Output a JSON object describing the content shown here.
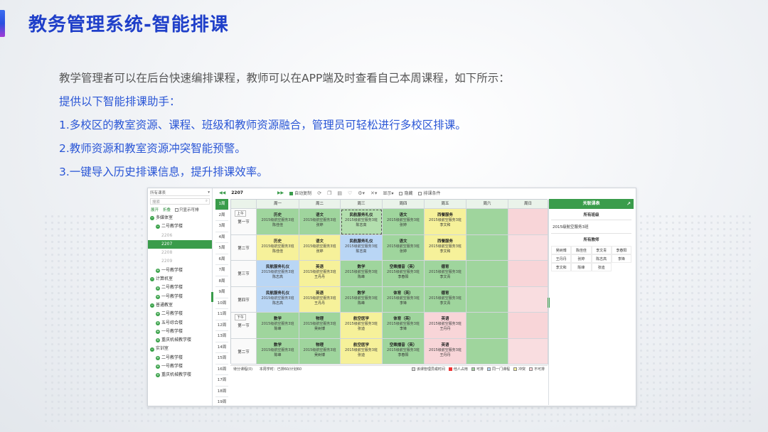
{
  "slide": {
    "title": "教务管理系统-智能排课",
    "intro": [
      "教学管理者可以在后台快速编排课程，教师可以在APP端及时查看自己本周课程，如下所示：",
      "提供以下智能排课助手：",
      "1.多校区的教室资源、课程、班级和教师资源融合，管理员可轻松进行多校区排课。",
      "2.教师资源和教室资源冲突智能预警。",
      "3.一键导入历史排课信息，提升排课效率。"
    ]
  },
  "app": {
    "tree": {
      "select_label": "所有课表",
      "search_placeholder": "搜索",
      "expand": "展开",
      "collapse": "折叠",
      "only_show": "只显示可排",
      "items": [
        {
          "label": "多媒体室",
          "level": 0,
          "icon": "minus"
        },
        {
          "label": "二号教学楼",
          "level": 1,
          "icon": "minus"
        },
        {
          "label": "2206",
          "level": 2,
          "icon": ""
        },
        {
          "label": "2207",
          "level": 2,
          "icon": "",
          "selected": true
        },
        {
          "label": "2208",
          "level": 2,
          "icon": ""
        },
        {
          "label": "2209",
          "level": 2,
          "icon": ""
        },
        {
          "label": "一号教学楼",
          "level": 1,
          "icon": "plus"
        },
        {
          "label": "计算机室",
          "level": 0,
          "icon": "minus"
        },
        {
          "label": "二号教学楼",
          "level": 1,
          "icon": "plus"
        },
        {
          "label": "一号教学楼",
          "level": 1,
          "icon": "plus"
        },
        {
          "label": "普通教室",
          "level": 0,
          "icon": "minus"
        },
        {
          "label": "二号教学楼",
          "level": 1,
          "icon": "plus"
        },
        {
          "label": "五号综合楼",
          "level": 1,
          "icon": "plus"
        },
        {
          "label": "一号教学楼",
          "level": 1,
          "icon": "plus"
        },
        {
          "label": "重庆机械教学楼",
          "level": 1,
          "icon": "plus"
        },
        {
          "label": "实训室",
          "level": 0,
          "icon": "minus"
        },
        {
          "label": "二号教学楼",
          "level": 1,
          "icon": "plus"
        },
        {
          "label": "一号教学楼",
          "level": 1,
          "icon": "plus"
        },
        {
          "label": "重庆机械教学楼",
          "level": 1,
          "icon": "plus"
        }
      ]
    },
    "toolbar": {
      "room": "2207",
      "auto": "自动复制",
      "show": "显示",
      "hide": "隐藏",
      "sort_conflict": "排课条件"
    },
    "weeks": [
      "1周",
      "2周",
      "3周",
      "4周",
      "5周",
      "6周",
      "7周",
      "8周",
      "9周",
      "10周",
      "11周",
      "12周",
      "13周",
      "14周",
      "15周",
      "16周",
      "17周",
      "18周",
      "19周"
    ],
    "days": [
      "周一",
      "周二",
      "周三",
      "周四",
      "周五",
      "周六",
      "周日"
    ],
    "am": "上午",
    "pm": "下午",
    "periods": [
      "第一节",
      "第二节",
      "第三节",
      "第四节",
      "第一节",
      "第二节"
    ],
    "cells": [
      [
        {
          "t": "历史",
          "s": "2015级航空服务3班",
          "n": "陈佳佳",
          "c": "g"
        },
        {
          "t": "语文",
          "s": "2015级航空服务3班",
          "n": "张婷",
          "c": "g"
        },
        {
          "t": "民航服务礼仪",
          "s": "2015级航空服务3班",
          "n": "陈志高",
          "c": "gd",
          "sel": true
        },
        {
          "t": "语文",
          "s": "2015级航空服务3班",
          "n": "张婷",
          "c": "g"
        },
        {
          "t": "西餐服务",
          "s": "2015级航空服务3班",
          "n": "李文和",
          "c": "y"
        },
        {
          "c": "g"
        },
        {
          "c": "p"
        }
      ],
      [
        {
          "t": "历史",
          "s": "2015级航空服务3班",
          "n": "陈佳佳",
          "c": "y"
        },
        {
          "t": "语文",
          "s": "2015级航空服务3班",
          "n": "张婷",
          "c": "y"
        },
        {
          "t": "民航服务礼仪",
          "s": "2015级航空服务3班",
          "n": "陈志高",
          "c": "b"
        },
        {
          "t": "语文",
          "s": "2015级航空服务3班",
          "n": "张婷",
          "c": "g"
        },
        {
          "t": "西餐服务",
          "s": "2015级航空服务3班",
          "n": "李文和",
          "c": "y"
        },
        {
          "c": "g"
        },
        {
          "c": "pe"
        }
      ],
      [
        {
          "t": "民航服务礼仪",
          "s": "2015级航空服务3班",
          "n": "陈志高",
          "c": "b"
        },
        {
          "t": "英语",
          "s": "2015级航空服务3班",
          "n": "王丹丹",
          "c": "y"
        },
        {
          "t": "数学",
          "s": "2015级航空服务3班",
          "n": "陈峰",
          "c": "g"
        },
        {
          "t": "空乘播音（英）",
          "s": "2015级航空服务3班",
          "n": "李春阳",
          "c": "g"
        },
        {
          "t": "德育",
          "s": "2015级航空服务3班",
          "n": "李文青",
          "c": "g"
        },
        {
          "c": "g"
        },
        {
          "c": "p"
        }
      ],
      [
        {
          "t": "民航服务礼仪",
          "s": "2015级航空服务3班",
          "n": "陈志高",
          "c": "b"
        },
        {
          "t": "英语",
          "s": "2015级航空服务3班",
          "n": "王丹丹",
          "c": "y"
        },
        {
          "t": "数学",
          "s": "2015级航空服务3班",
          "n": "陈峰",
          "c": "g"
        },
        {
          "t": "体育（英）",
          "s": "2015级航空服务3班",
          "n": "李锋",
          "c": "g"
        },
        {
          "t": "德育",
          "s": "2015级航空服务3班",
          "n": "李文青",
          "c": "g"
        },
        {
          "c": "g"
        },
        {
          "c": "pe"
        }
      ],
      [
        {
          "t": "数学",
          "s": "2015级航空服务3班",
          "n": "陈峰",
          "c": "g"
        },
        {
          "t": "物理",
          "s": "2015级航空服务3班",
          "n": "吴树博",
          "c": "g"
        },
        {
          "t": "航空医学",
          "s": "2015级航空服务3班",
          "n": "张迪",
          "c": "y"
        },
        {
          "t": "体育（英）",
          "s": "2015级航空服务3班",
          "n": "李锋",
          "c": "g"
        },
        {
          "t": "英语",
          "s": "2015级航空服务3班",
          "n": "王丹丹",
          "c": "p"
        },
        {
          "c": "g"
        },
        {
          "c": "p"
        }
      ],
      [
        {
          "t": "数学",
          "s": "2015级航空服务3班",
          "n": "陈峰",
          "c": "g"
        },
        {
          "t": "物理",
          "s": "2015级航空服务3班",
          "n": "吴树博",
          "c": "g"
        },
        {
          "t": "航空医学",
          "s": "2015级航空服务3班",
          "n": "张迪",
          "c": "y"
        },
        {
          "t": "空乘播音（英）",
          "s": "2015级航空服务3班",
          "n": "李春阳",
          "c": "g"
        },
        {
          "t": "英语",
          "s": "2015级航空服务3班",
          "n": "王丹丹",
          "c": "p"
        },
        {
          "c": "g"
        },
        {
          "c": "pe"
        }
      ]
    ],
    "status": {
      "pending": "待分课程(0)",
      "week_hours": "本周学时：已排60/计划60"
    },
    "legend": [
      "该课管理员或时间",
      "他人占用",
      "可排",
      "同一门课程",
      "冲突",
      "不可排"
    ],
    "right": {
      "header": "关联课表",
      "classes_title": "所有班级",
      "class_name": "2015级航空服务3班",
      "teachers_title": "所有教师",
      "teachers": [
        "吴树博",
        "陈佳佳",
        "李文青",
        "李春阳",
        "王丹丹",
        "张婷",
        "陈志高",
        "李锋",
        "李文和",
        "陈峰",
        "张迪"
      ]
    },
    "colors": {
      "accent": "#3a9c4b",
      "title": "#1f3fc9",
      "link": "#2a56d6"
    }
  }
}
